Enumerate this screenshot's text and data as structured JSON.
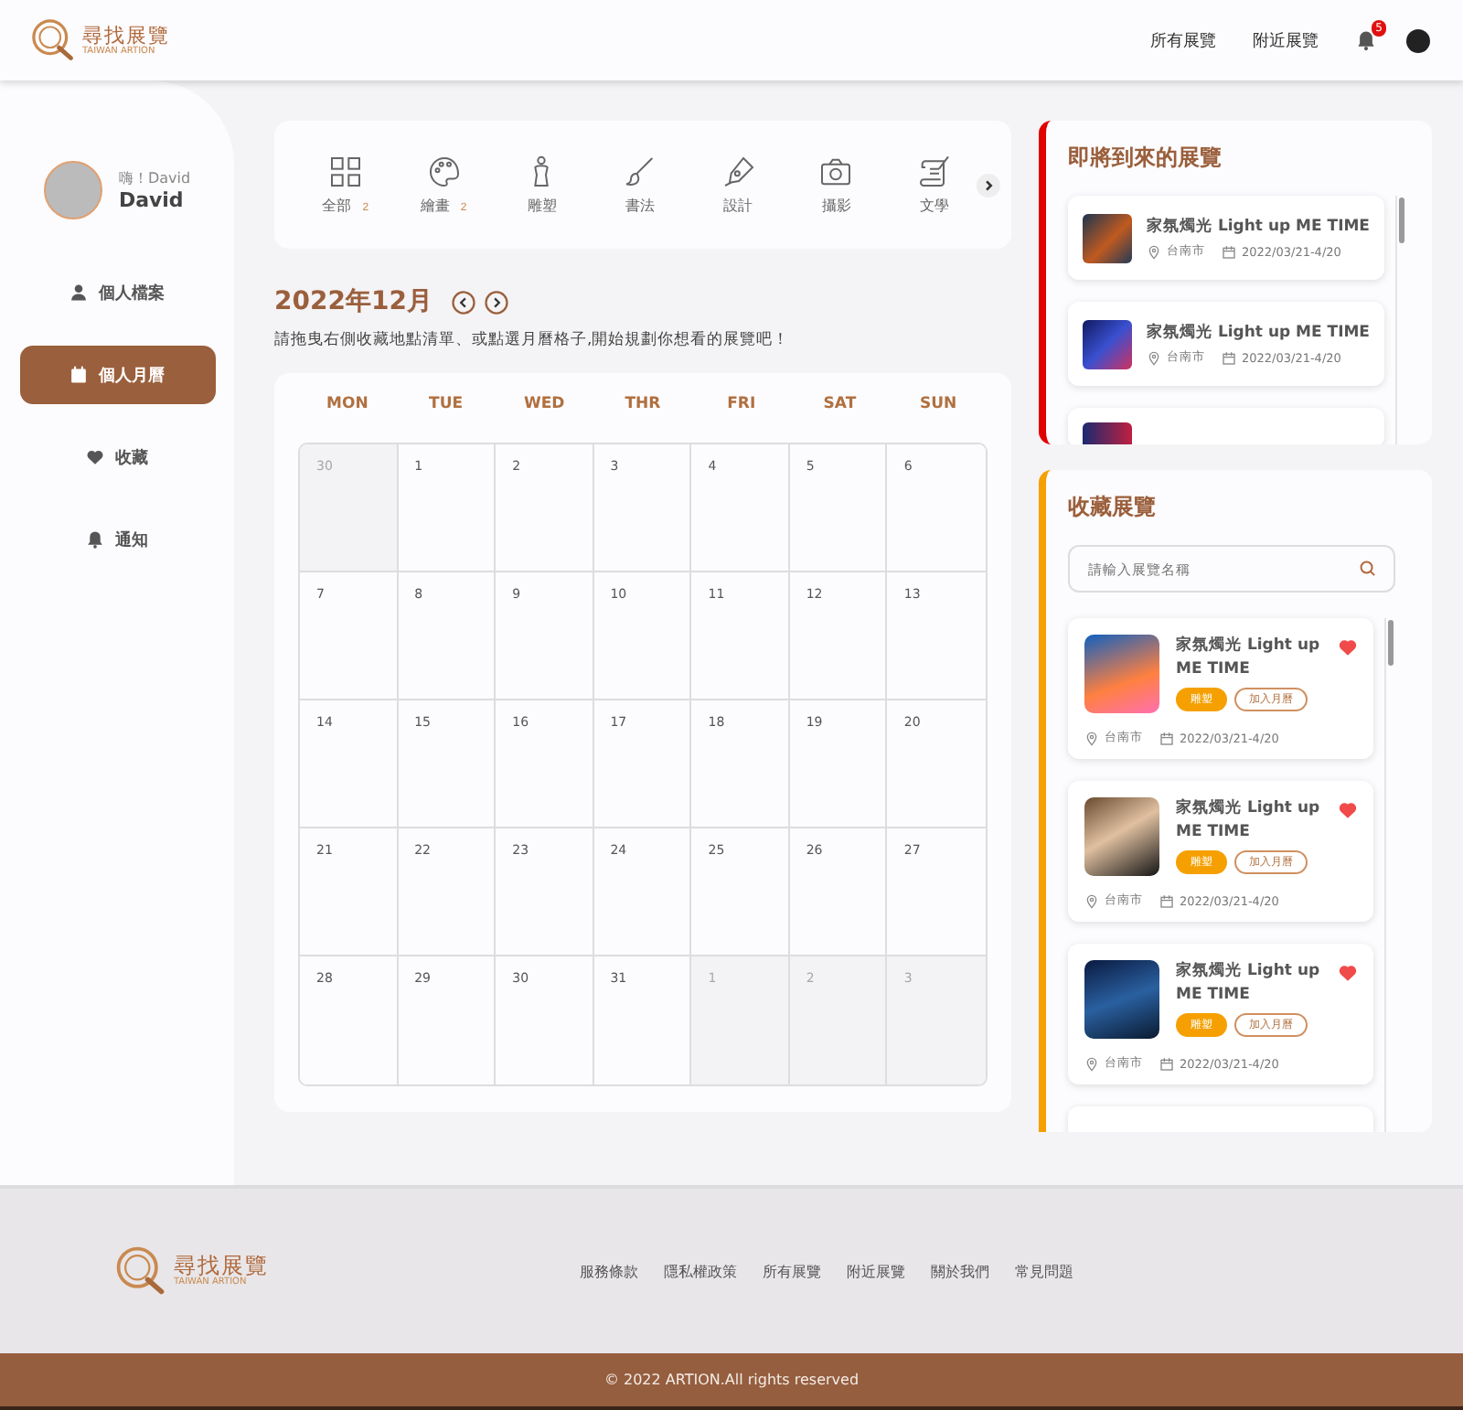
{
  "header": {
    "logo_title": "尋找展覽",
    "logo_subtitle": "TAIWAN ARTION",
    "links": [
      "所有展覽",
      "附近展覽"
    ],
    "notification_count": "5"
  },
  "sidebar": {
    "greeting": "嗨！David",
    "name": "David",
    "items": [
      {
        "label": "個人檔案",
        "selected": false
      },
      {
        "label": "個人月曆",
        "selected": true
      },
      {
        "label": "收藏",
        "selected": false
      },
      {
        "label": "通知",
        "selected": false
      }
    ]
  },
  "categories": [
    {
      "label": "全部",
      "count": "2"
    },
    {
      "label": "繪畫",
      "count": "2"
    },
    {
      "label": "雕塑"
    },
    {
      "label": "書法"
    },
    {
      "label": "設計"
    },
    {
      "label": "攝影"
    },
    {
      "label": "文學"
    }
  ],
  "calendar": {
    "title": "2022年12月",
    "hint": "請拖曳右側收藏地點清單、或點選月曆格子,開始規劃你想看的展覽吧！",
    "weekdays": [
      "MON",
      "TUE",
      "WED",
      "THR",
      "FRI",
      "SAT",
      "SUN"
    ],
    "days": [
      {
        "label": "30",
        "muted": true
      },
      {
        "label": "1",
        "muted": false
      },
      {
        "label": "2",
        "muted": false
      },
      {
        "label": "3",
        "muted": false
      },
      {
        "label": "4",
        "muted": false
      },
      {
        "label": "5",
        "muted": false
      },
      {
        "label": "6",
        "muted": false
      },
      {
        "label": "7",
        "muted": false
      },
      {
        "label": "8",
        "muted": false
      },
      {
        "label": "9",
        "muted": false
      },
      {
        "label": "10",
        "muted": false
      },
      {
        "label": "11",
        "muted": false
      },
      {
        "label": "12",
        "muted": false
      },
      {
        "label": "13",
        "muted": false
      },
      {
        "label": "14",
        "muted": false
      },
      {
        "label": "15",
        "muted": false
      },
      {
        "label": "16",
        "muted": false
      },
      {
        "label": "17",
        "muted": false
      },
      {
        "label": "18",
        "muted": false
      },
      {
        "label": "19",
        "muted": false
      },
      {
        "label": "20",
        "muted": false
      },
      {
        "label": "21",
        "muted": false
      },
      {
        "label": "22",
        "muted": false
      },
      {
        "label": "23",
        "muted": false
      },
      {
        "label": "24",
        "muted": false
      },
      {
        "label": "25",
        "muted": false
      },
      {
        "label": "26",
        "muted": false
      },
      {
        "label": "27",
        "muted": false
      },
      {
        "label": "28",
        "muted": false
      },
      {
        "label": "29",
        "muted": false
      },
      {
        "label": "30",
        "muted": false
      },
      {
        "label": "31",
        "muted": false
      },
      {
        "label": "1",
        "muted": true
      },
      {
        "label": "2",
        "muted": true
      },
      {
        "label": "3",
        "muted": true
      }
    ]
  },
  "upcoming": {
    "title": "即將到來的展覽",
    "items": [
      {
        "title": "家氛燭光 Light up ME TIME",
        "location": "台南市",
        "date": "2022/03/21-4/20"
      },
      {
        "title": "家氛燭光 Light up ME TIME",
        "location": "台南市",
        "date": "2022/03/21-4/20"
      }
    ]
  },
  "favorites": {
    "title": "收藏展覽",
    "search": {
      "placeholder": "請輸入展覽名稱"
    },
    "items": [
      {
        "title": "家氛燭光 Light up ME TIME",
        "tag": "雕塑",
        "action": "加入月曆",
        "liked": true,
        "location": "台南市",
        "date": "2022/03/21-4/20"
      },
      {
        "title": "家氛燭光 Light up ME TIME",
        "tag": "雕塑",
        "action": "加入月曆",
        "liked": true,
        "location": "台南市",
        "date": "2022/03/21-4/20"
      },
      {
        "title": "家氛燭光 Light up ME TIME",
        "tag": "雕塑",
        "action": "加入月曆",
        "liked": true,
        "location": "台南市",
        "date": "2022/03/21-4/20"
      }
    ]
  },
  "footer": {
    "logo_title": "尋找展覽",
    "logo_subtitle": "TAIWAN ARTION",
    "links": [
      "服務條款",
      "隱私權政策",
      "所有展覽",
      "附近展覽",
      "關於我們",
      "常見問題"
    ],
    "copyright": "© 2022 ARTION.All rights reserved"
  }
}
